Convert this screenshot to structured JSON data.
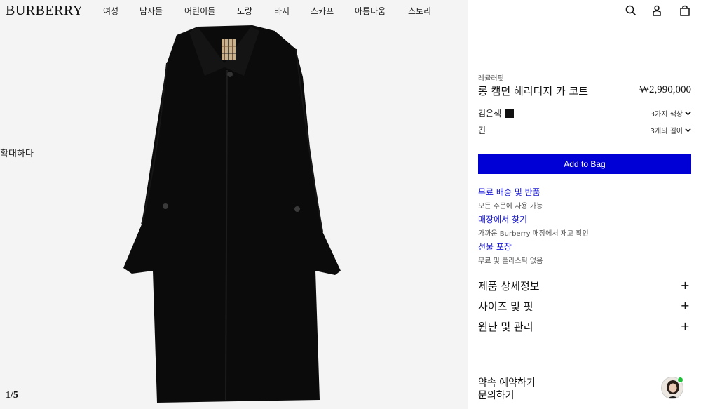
{
  "header": {
    "logo": "BURBERRY",
    "nav": [
      "여성",
      "남자들",
      "어린이들",
      "도랑",
      "바지",
      "스카프",
      "아름다움",
      "스토리"
    ]
  },
  "gallery": {
    "zoom_label": "확대하다",
    "counter": "1/5"
  },
  "icons": {
    "search": "search-icon",
    "account": "account-icon",
    "bag": "bag-icon"
  },
  "product": {
    "badge": "레귤러핏",
    "title": "롱 캠던 헤리티지 카 코트",
    "price": "₩2,990,000",
    "color_label": "검은색",
    "color_hex": "#111111",
    "color_options": "3가지 색상",
    "length_label": "긴",
    "length_options": "3개의 길이",
    "add_to_bag": "Add to Bag"
  },
  "services": [
    {
      "title": "무료 배송 및 반품",
      "sub": "모든 주문에 사용 가능"
    },
    {
      "title": "매장에서 찾기",
      "sub": "가까운 Burberry 매장에서 재고 확인"
    },
    {
      "title": "선물 포장",
      "sub": "무료 및 플라스틱 없음"
    }
  ],
  "accordions": [
    {
      "label": "제품 상세정보",
      "icon": "+"
    },
    {
      "label": "사이즈 및 핏",
      "icon": "+"
    },
    {
      "label": "원단 및 관리",
      "icon": "+"
    }
  ],
  "appointment": {
    "line1": "약속 예약하기",
    "line2": "문의하기"
  },
  "colors": {
    "accent_button": "#0000d6",
    "link": "#1a1ad6",
    "gallery_bg": "#f4f4f4"
  }
}
